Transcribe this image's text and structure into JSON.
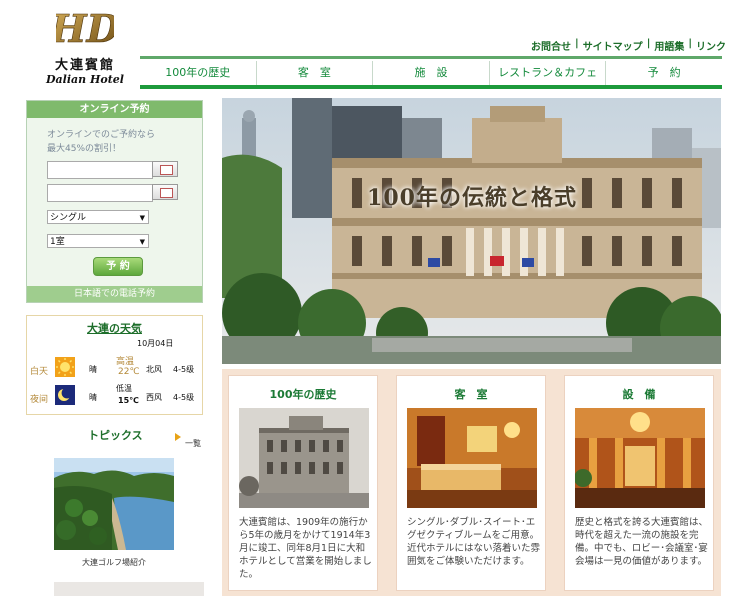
{
  "brand": {
    "logo_mark": "HD",
    "name_cn": "大連賓館",
    "name_en": "Dalian Hotel"
  },
  "top_links": [
    {
      "label": "お問合せ"
    },
    {
      "label": "サイトマップ"
    },
    {
      "label": "用語集"
    },
    {
      "label": "リンク"
    }
  ],
  "top_links_separator": "|",
  "nav": [
    {
      "label": "100年の歴史"
    },
    {
      "label": "客　室"
    },
    {
      "label": "施　設"
    },
    {
      "label": "レストラン＆カフェ"
    },
    {
      "label": "予　約"
    }
  ],
  "booking": {
    "title": "オンライン予約",
    "promo_line1": "オンラインでのご予約なら",
    "promo_line2": "最大45%の割引！",
    "checkin_value": "",
    "checkout_value": "",
    "room_type": "シングル",
    "room_count": "1室",
    "reserve_button": "予 約",
    "phone_link": "日本語での電話予約"
  },
  "weather": {
    "title": "大連の天気",
    "date": "10月04日",
    "rows": [
      {
        "period": "白天",
        "icon": "sun-icon",
        "condition": "晴",
        "temp_label": "高温",
        "temp": "22℃",
        "wind_dir": "北风",
        "wind": "4-5级"
      },
      {
        "period": "夜间",
        "icon": "moon-icon",
        "condition": "晴",
        "temp_label": "低温",
        "temp": "15℃",
        "wind_dir": "西风",
        "wind": "4-5级"
      }
    ]
  },
  "topics": {
    "title": "トピックス",
    "more": "一覧",
    "item_caption": "大連ゴルフ場紹介"
  },
  "hero": {
    "title": "100年の伝統と格式"
  },
  "cards": [
    {
      "title": "100年の歴史",
      "text": "大連賓館は、1909年の施行から5年の歳月をかけて1914年3月に竣工、同年8月1日に大和ホテルとして営業を開始しました。"
    },
    {
      "title": "客　室",
      "text": "シングル･ダブル･スイート･エグゼクティブルームをご用意。近代ホテルにはない落着いた雰囲気をご体験いただけます。"
    },
    {
      "title": "設　備",
      "text": "歴史と格式を誇る大連賓館は、時代を超えた一流の施設を完備。中でも、ロビー･会議室･宴会場は一見の価値があります。"
    }
  ],
  "colors": {
    "brand_green": "#1d9a3c",
    "link_green": "#1d6e2a",
    "panel_green": "#7fba6c",
    "card_bg": "#f6e3d3"
  }
}
